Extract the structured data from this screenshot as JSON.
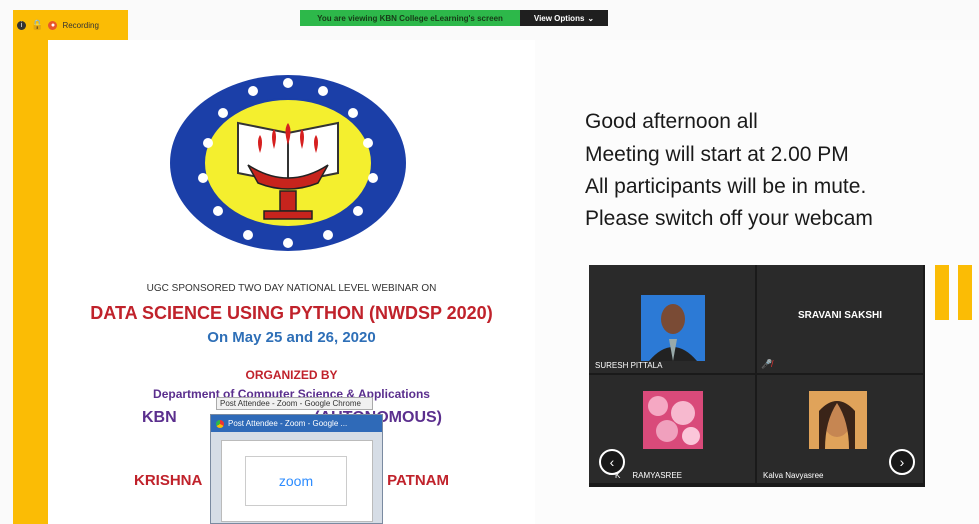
{
  "topbar": {
    "recording_label": "Recording",
    "viewing_text": "You are viewing KBN College eLearning's screen",
    "view_options_label": "View Options",
    "view_options_chevron": "⌄"
  },
  "slide": {
    "line1": "UGC SPONSORED TWO DAY NATIONAL LEVEL WEBINAR ON",
    "line2": "DATA SCIENCE USING PYTHON (NWDSP 2020)",
    "line3": "On May 25 and 26, 2020",
    "line4": "ORGANIZED BY",
    "line5": "Department of Computer Science & Applications",
    "line6": "KBN (AUTONOMOUS)",
    "line7": "KRISHNA PATNAM"
  },
  "popup": {
    "tooltip": "Post Attendee - Zoom - Google Chrome",
    "window_title": "Post Attendee - Zoom - Google ...",
    "zoom_label": "zoom"
  },
  "message": {
    "line1": "Good afternoon all",
    "line2": "Meeting will start at 2.00 PM",
    "line3": "All participants will be in mute.",
    "line4": "Please switch off your webcam"
  },
  "participants": [
    {
      "name": "SURESH PITTALA"
    },
    {
      "name": "SRAVANI SAKSHI"
    },
    {
      "name": "RAMYASREE",
      "prefix": "K"
    },
    {
      "name": "Kalva Navyasree"
    }
  ],
  "colors": {
    "accent_yellow": "#fbbc05",
    "banner_green": "#2db84a",
    "title_red": "#c0222b",
    "subtitle_blue": "#2e6fb7",
    "org_purple": "#5b2f8e"
  }
}
